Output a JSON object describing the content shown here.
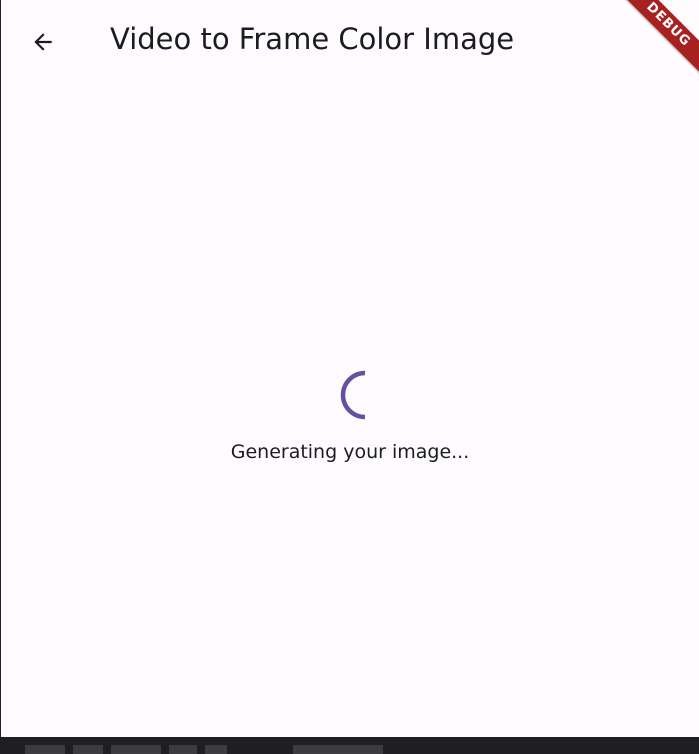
{
  "appbar": {
    "back_icon": "arrow-back-icon",
    "title": "Video to Frame Color Image"
  },
  "main": {
    "spinner_color": "#6750a4",
    "loading_text": "Generating your image..."
  },
  "banner": {
    "label": "DEBUG",
    "color": "#a72121"
  },
  "background": {
    "color": "#fefbff"
  }
}
